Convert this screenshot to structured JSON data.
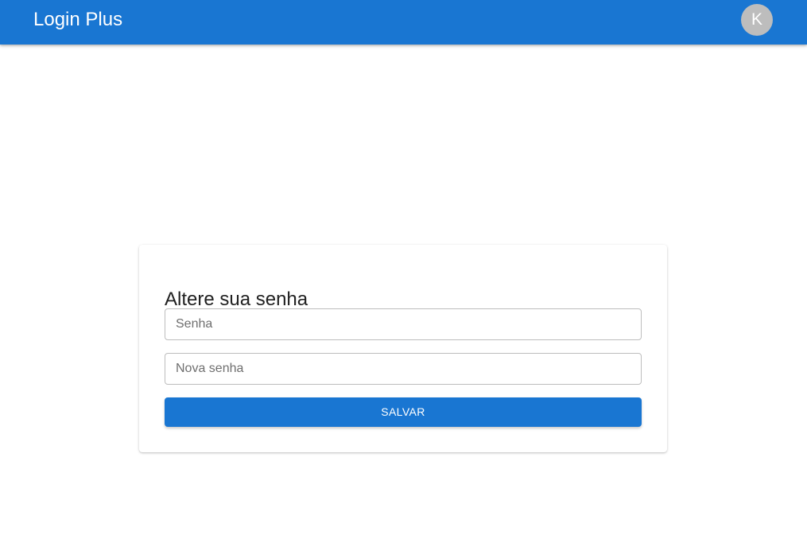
{
  "appbar": {
    "title": "Login Plus",
    "avatar_initial": "K",
    "background_color": "#1976d2",
    "avatar_color": "#bdbdbd"
  },
  "form": {
    "title": "Altere sua senha",
    "password_field": {
      "value": "",
      "placeholder": "Senha"
    },
    "new_password_field": {
      "value": "",
      "placeholder": "Nova senha"
    },
    "save_label": "SALVAR",
    "save_color": "#1976d2"
  }
}
